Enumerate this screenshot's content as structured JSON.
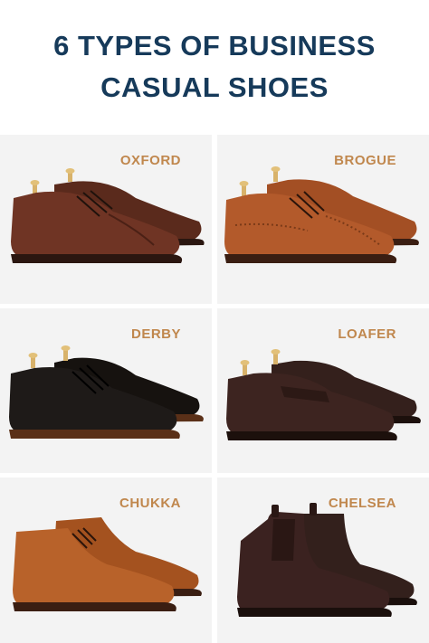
{
  "title": {
    "line1": "6 TYPES OF BUSINESS",
    "line2": "CASUAL SHOES"
  },
  "shoes": [
    {
      "label": "OXFORD",
      "color": "#6f3424"
    },
    {
      "label": "BROGUE",
      "color": "#b35a2b"
    },
    {
      "label": "DERBY",
      "color": "#1e1a18"
    },
    {
      "label": "LOAFER",
      "color": "#3d2420"
    },
    {
      "label": "CHUKKA",
      "color": "#b8622a"
    },
    {
      "label": "CHELSEA",
      "color": "#3b2220"
    }
  ],
  "colors": {
    "title": "#163a5a",
    "label": "#c0874d",
    "tile_background": "#f3f3f3"
  }
}
